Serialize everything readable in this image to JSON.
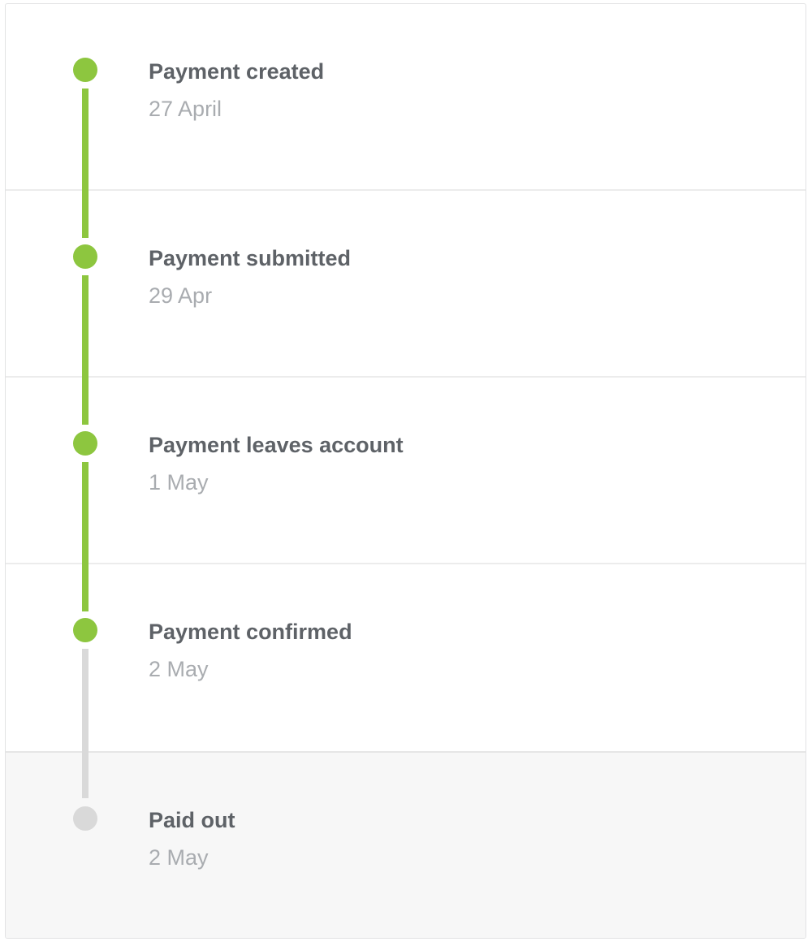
{
  "colors": {
    "complete": "#8dc63f",
    "pending": "#d9d9d9",
    "title": "#5e6267",
    "date": "#a9acb0"
  },
  "steps": [
    {
      "title": "Payment created",
      "date": "27 April",
      "status": "complete"
    },
    {
      "title": "Payment submitted",
      "date": "29 Apr",
      "status": "complete"
    },
    {
      "title": "Payment leaves account",
      "date": "1 May",
      "status": "complete"
    },
    {
      "title": "Payment confirmed",
      "date": "2 May",
      "status": "complete"
    },
    {
      "title": "Paid out",
      "date": "2 May",
      "status": "pending"
    }
  ]
}
